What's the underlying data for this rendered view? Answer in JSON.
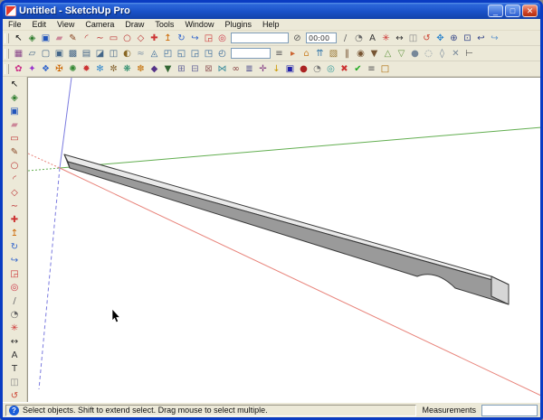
{
  "window": {
    "title": "Untitled - SketchUp Pro",
    "controls": {
      "minimize": "_",
      "maximize": "□",
      "close": "✕"
    }
  },
  "menu": {
    "items": [
      "File",
      "Edit",
      "View",
      "Camera",
      "Draw",
      "Tools",
      "Window",
      "Plugins",
      "Help"
    ]
  },
  "toolbars": {
    "row1": [
      {
        "name": "select-tool-icon",
        "g": "↖",
        "c": "#111111"
      },
      {
        "name": "make-component-icon",
        "g": "◈",
        "c": "#2a7a2a"
      },
      {
        "name": "paint-bucket-icon",
        "g": "▣",
        "c": "#2255bb"
      },
      {
        "name": "eraser-icon",
        "g": "▰",
        "c": "#cc8899"
      },
      {
        "name": "line-tool-icon",
        "g": "✎",
        "c": "#884422"
      },
      {
        "name": "arc-tool-icon",
        "g": "◜",
        "c": "#bb3333"
      },
      {
        "name": "freehand-tool-icon",
        "g": "∼",
        "c": "#bb3333"
      },
      {
        "name": "rectangle-tool-icon",
        "g": "▭",
        "c": "#bb3333"
      },
      {
        "name": "circle-tool-icon",
        "g": "○",
        "c": "#bb3333"
      },
      {
        "name": "polygon-tool-icon",
        "g": "◇",
        "c": "#bb3333"
      },
      {
        "name": "move-tool-icon",
        "g": "✚",
        "c": "#cc3333"
      },
      {
        "name": "push-pull-tool-icon",
        "g": "↥",
        "c": "#cc6600"
      },
      {
        "name": "rotate-tool-icon",
        "g": "↻",
        "c": "#3366cc"
      },
      {
        "name": "follow-me-tool-icon",
        "g": "↪",
        "c": "#3366cc"
      },
      {
        "name": "scale-tool-icon",
        "g": "◲",
        "c": "#cc3333"
      },
      {
        "name": "offset-tool-icon",
        "g": "◎",
        "c": "#cc3344"
      },
      {
        "name": "toolbar-field",
        "box": true,
        "w": 64,
        "label": ""
      },
      {
        "name": "time-icon",
        "g": "⊘",
        "c": "#555555"
      },
      {
        "name": "time-field",
        "box": true,
        "w": 34,
        "label": "00:00"
      },
      {
        "name": "tape-measure-icon",
        "g": "/",
        "c": "#666666"
      },
      {
        "name": "protractor-icon",
        "g": "◔",
        "c": "#666666"
      },
      {
        "name": "text-tool-icon",
        "g": "A",
        "c": "#333333"
      },
      {
        "name": "axes-tool-icon",
        "g": "✳",
        "c": "#cc3333"
      },
      {
        "name": "dimension-tool-icon",
        "g": "↔",
        "c": "#333333"
      },
      {
        "name": "section-plane-icon",
        "g": "◫",
        "c": "#888888"
      },
      {
        "name": "orbit-tool-icon",
        "g": "↺",
        "c": "#cc4433"
      },
      {
        "name": "pan-tool-icon",
        "g": "✥",
        "c": "#3388cc"
      },
      {
        "name": "zoom-tool-icon",
        "g": "⊕",
        "c": "#334488"
      },
      {
        "name": "zoom-extents-icon",
        "g": "⊡",
        "c": "#334488"
      },
      {
        "name": "previous-view-icon",
        "g": "↩",
        "c": "#334488"
      },
      {
        "name": "next-view-icon",
        "g": "↪",
        "c": "#6699cc"
      }
    ],
    "row2": [
      {
        "name": "open-icon",
        "g": "▦",
        "c": "#884488"
      },
      {
        "name": "style-wireframe-icon",
        "g": "▱",
        "c": "#446688"
      },
      {
        "name": "style-hidden-line-icon",
        "g": "▢",
        "c": "#446688"
      },
      {
        "name": "style-shaded-icon",
        "g": "▣",
        "c": "#446688"
      },
      {
        "name": "style-textured-icon",
        "g": "▩",
        "c": "#446688"
      },
      {
        "name": "style-monochrome-icon",
        "g": "▤",
        "c": "#446688"
      },
      {
        "name": "xray-mode-icon",
        "g": "◪",
        "c": "#446688"
      },
      {
        "name": "back-edges-icon",
        "g": "◫",
        "c": "#446688"
      },
      {
        "name": "shadows-toggle-icon",
        "g": "◐",
        "c": "#886622"
      },
      {
        "name": "fog-toggle-icon",
        "g": "≈",
        "c": "#8899aa"
      },
      {
        "name": "iso-view-icon",
        "g": "◬",
        "c": "#336699"
      },
      {
        "name": "top-view-icon",
        "g": "◰",
        "c": "#336699"
      },
      {
        "name": "front-view-icon",
        "g": "◱",
        "c": "#336699"
      },
      {
        "name": "right-view-icon",
        "g": "◲",
        "c": "#336699"
      },
      {
        "name": "back-view-icon",
        "g": "◳",
        "c": "#336699"
      },
      {
        "name": "left-view-icon",
        "g": "◴",
        "c": "#336699"
      },
      {
        "name": "camera-dropdown",
        "box": true,
        "w": 44,
        "label": ""
      },
      {
        "name": "layers-icon",
        "g": "≡",
        "c": "#555555"
      },
      {
        "name": "flag-icon",
        "g": "▸",
        "c": "#cc6633"
      },
      {
        "name": "get-models-icon",
        "g": "⌂",
        "c": "#cc8833"
      },
      {
        "name": "share-model-icon",
        "g": "⇈",
        "c": "#3377aa"
      },
      {
        "name": "photo-textures-icon",
        "g": "▧",
        "c": "#997733"
      },
      {
        "name": "walk-tool-icon",
        "g": "‖",
        "c": "#775533"
      },
      {
        "name": "look-around-icon",
        "g": "◉",
        "c": "#775533"
      },
      {
        "name": "position-camera-icon",
        "g": "▼",
        "c": "#775533"
      },
      {
        "name": "sandbox-from-contours-icon",
        "g": "△",
        "c": "#669944"
      },
      {
        "name": "sandbox-from-scratch-icon",
        "g": "▽",
        "c": "#669944"
      },
      {
        "name": "solid-union-icon",
        "g": "●",
        "c": "#778899"
      },
      {
        "name": "solid-subtract-icon",
        "g": "◌",
        "c": "#778899"
      },
      {
        "name": "solid-trim-icon",
        "g": "◊",
        "c": "#778899"
      },
      {
        "name": "solid-intersect-icon",
        "g": "✕",
        "c": "#778899"
      },
      {
        "name": "dimension-style-icon",
        "g": "⊢",
        "c": "#555555"
      }
    ],
    "row3": [
      {
        "name": "plugin-flower-icon",
        "g": "✿",
        "c": "#cc3388"
      },
      {
        "name": "plugin-star-icon",
        "g": "✦",
        "c": "#9933cc"
      },
      {
        "name": "plugin-diamond-icon",
        "g": "❖",
        "c": "#3366cc"
      },
      {
        "name": "plugin-cross-icon",
        "g": "✠",
        "c": "#cc6600"
      },
      {
        "name": "plugin-gear-icon",
        "g": "✺",
        "c": "#338833"
      },
      {
        "name": "plugin-burst-icon",
        "g": "✹",
        "c": "#cc3333"
      },
      {
        "name": "plugin-snowflake-icon",
        "g": "✻",
        "c": "#3388cc"
      },
      {
        "name": "plugin-spark-icon",
        "g": "✼",
        "c": "#886633"
      },
      {
        "name": "plugin-asterisk-icon",
        "g": "❋",
        "c": "#228866"
      },
      {
        "name": "plugin-petal-icon",
        "g": "✽",
        "c": "#cc8833"
      },
      {
        "name": "plugin-cube-icon",
        "g": "◆",
        "c": "#553388"
      },
      {
        "name": "plugin-wedge-icon",
        "g": "▼",
        "c": "#336633"
      },
      {
        "name": "plugin-grid-plus-icon",
        "g": "⊞",
        "c": "#666699"
      },
      {
        "name": "plugin-grid-minus-icon",
        "g": "⊟",
        "c": "#666699"
      },
      {
        "name": "plugin-grid-x-icon",
        "g": "⊠",
        "c": "#996666"
      },
      {
        "name": "plugin-join-icon",
        "g": "⋈",
        "c": "#338899"
      },
      {
        "name": "plugin-loop-icon",
        "g": "∞",
        "c": "#884444"
      },
      {
        "name": "plugin-list-icon",
        "g": "≣",
        "c": "#444488"
      },
      {
        "name": "plugin-target-icon",
        "g": "✛",
        "c": "#884488"
      },
      {
        "name": "plugin-arrow-down-icon",
        "g": "↓",
        "c": "#cc9900"
      },
      {
        "name": "plugin-panel-icon",
        "g": "▣",
        "c": "#2222aa"
      },
      {
        "name": "plugin-dot-icon",
        "g": "●",
        "c": "#aa2222"
      },
      {
        "name": "plugin-clock-icon",
        "g": "◔",
        "c": "#777777"
      },
      {
        "name": "plugin-ring-icon",
        "g": "◎",
        "c": "#339999"
      },
      {
        "name": "plugin-close-icon",
        "g": "✖",
        "c": "#cc3333"
      },
      {
        "name": "plugin-check-icon",
        "g": "✔",
        "c": "#22aa22"
      },
      {
        "name": "plugin-menu-icon",
        "g": "≡",
        "c": "#555555"
      },
      {
        "name": "plugin-box-icon",
        "g": "□",
        "c": "#aa6600"
      }
    ],
    "left": [
      {
        "name": "select-tool-icon",
        "g": "↖",
        "c": "#111111"
      },
      {
        "name": "make-component-icon",
        "g": "◈",
        "c": "#2a7a2a"
      },
      {
        "name": "paint-bucket-icon",
        "g": "▣",
        "c": "#2255bb"
      },
      {
        "name": "eraser-icon",
        "g": "▰",
        "c": "#cc8899"
      },
      {
        "name": "rectangle-tool-icon",
        "g": "▭",
        "c": "#bb3333"
      },
      {
        "name": "line-tool-icon",
        "g": "✎",
        "c": "#884422"
      },
      {
        "name": "circle-tool-icon",
        "g": "○",
        "c": "#bb3333"
      },
      {
        "name": "arc-tool-icon",
        "g": "◜",
        "c": "#bb3333"
      },
      {
        "name": "polygon-tool-icon",
        "g": "◇",
        "c": "#bb3333"
      },
      {
        "name": "freehand-tool-icon",
        "g": "∼",
        "c": "#bb3333"
      },
      {
        "name": "move-tool-icon",
        "g": "✚",
        "c": "#cc3333"
      },
      {
        "name": "push-pull-tool-icon",
        "g": "↥",
        "c": "#cc6600"
      },
      {
        "name": "rotate-tool-icon",
        "g": "↻",
        "c": "#3366cc"
      },
      {
        "name": "follow-me-tool-icon",
        "g": "↪",
        "c": "#3366cc"
      },
      {
        "name": "scale-tool-icon",
        "g": "◲",
        "c": "#cc3333"
      },
      {
        "name": "offset-tool-icon",
        "g": "◎",
        "c": "#cc3344"
      },
      {
        "name": "tape-measure-icon",
        "g": "/",
        "c": "#666666"
      },
      {
        "name": "protractor-icon",
        "g": "◔",
        "c": "#666666"
      },
      {
        "name": "axes-tool-icon",
        "g": "✳",
        "c": "#cc3333"
      },
      {
        "name": "dimension-tool-icon",
        "g": "↔",
        "c": "#333333"
      },
      {
        "name": "text-tool-icon",
        "g": "A",
        "c": "#333333"
      },
      {
        "name": "3d-text-tool-icon",
        "g": "T",
        "c": "#333333"
      },
      {
        "name": "section-plane-icon",
        "g": "◫",
        "c": "#888888"
      },
      {
        "name": "orbit-tool-icon",
        "g": "↺",
        "c": "#cc4433"
      }
    ]
  },
  "canvas": {
    "background": "#ffffff",
    "axes": {
      "red": "#e8837a",
      "green": "#62ae50",
      "blue": "#7b7bdf"
    },
    "model": {
      "top": "#e9e9e9",
      "side": "#9a9a9a",
      "end": "#d6d6d6",
      "outline": "#3a3a3a"
    }
  },
  "statusbar": {
    "help_glyph": "?",
    "hint": "Select objects. Shift to extend select. Drag mouse to select multiple.",
    "measurements_label": "Measurements",
    "measurements_value": ""
  }
}
